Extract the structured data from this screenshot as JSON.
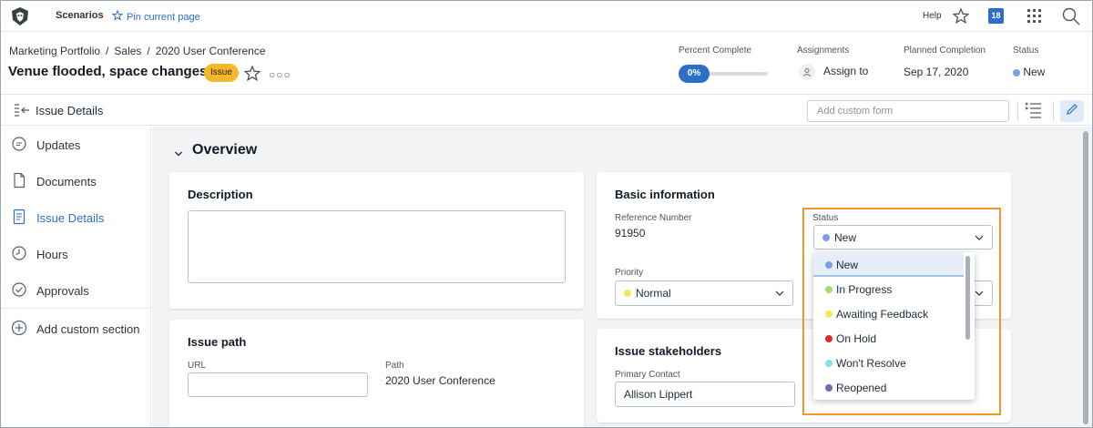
{
  "topbar": {
    "scenarios_label": "Scenarios",
    "pin_label": "Pin current page",
    "help_label": "Help",
    "notification_count": "18"
  },
  "header": {
    "breadcrumb": [
      "Marketing Portfolio",
      "/",
      "Sales",
      "/",
      "2020 User Conference"
    ],
    "title": "Venue flooded, space changes",
    "badge": "Issue",
    "percent_label": "Percent Complete",
    "percent_value": "0%",
    "percent_fraction": 0,
    "assignments_label": "Assignments",
    "assign_to": "Assign to",
    "planned_label": "Planned Completion",
    "planned_value": "Sep 17, 2020",
    "status_label": "Status",
    "status_value": "New"
  },
  "subheader": {
    "title": "Issue Details",
    "custom_form_placeholder": "Add custom form"
  },
  "sidebar": {
    "items": [
      {
        "label": "Updates",
        "icon": "chat-bubble-icon"
      },
      {
        "label": "Documents",
        "icon": "document-icon"
      },
      {
        "label": "Issue Details",
        "icon": "details-icon"
      },
      {
        "label": "Hours",
        "icon": "clock-icon"
      },
      {
        "label": "Approvals",
        "icon": "check-circle-icon"
      }
    ],
    "add_section": "Add custom section"
  },
  "main": {
    "overview_title": "Overview",
    "description": {
      "title": "Description",
      "value": ""
    },
    "issue_path": {
      "title": "Issue path",
      "url_label": "URL",
      "url_value": "",
      "path_label": "Path",
      "path_value": "2020 User Conference"
    },
    "basic_info": {
      "title": "Basic information",
      "ref_label": "Reference Number",
      "ref_value": "91950",
      "status_label": "Status",
      "status_value": "New",
      "priority_label": "Priority",
      "priority_value": "Normal"
    },
    "stakeholders": {
      "title": "Issue stakeholders",
      "primary_label": "Primary Contact",
      "primary_value": "Allison Lippert"
    }
  },
  "status_dropdown": {
    "options": [
      {
        "label": "New",
        "color": "#7b9ee8"
      },
      {
        "label": "In Progress",
        "color": "#9ee26a"
      },
      {
        "label": "Awaiting Feedback",
        "color": "#f2ea5b"
      },
      {
        "label": "On Hold",
        "color": "#e22b2b"
      },
      {
        "label": "Won't Resolve",
        "color": "#7fe0ee"
      },
      {
        "label": "Reopened",
        "color": "#6a6fb0"
      }
    ],
    "selected": "New"
  },
  "colors": {
    "accent": "#2d6ec9",
    "badge": "#f5b829",
    "highlight": "#f0962b",
    "priority_normal": "#f2ea5b"
  }
}
